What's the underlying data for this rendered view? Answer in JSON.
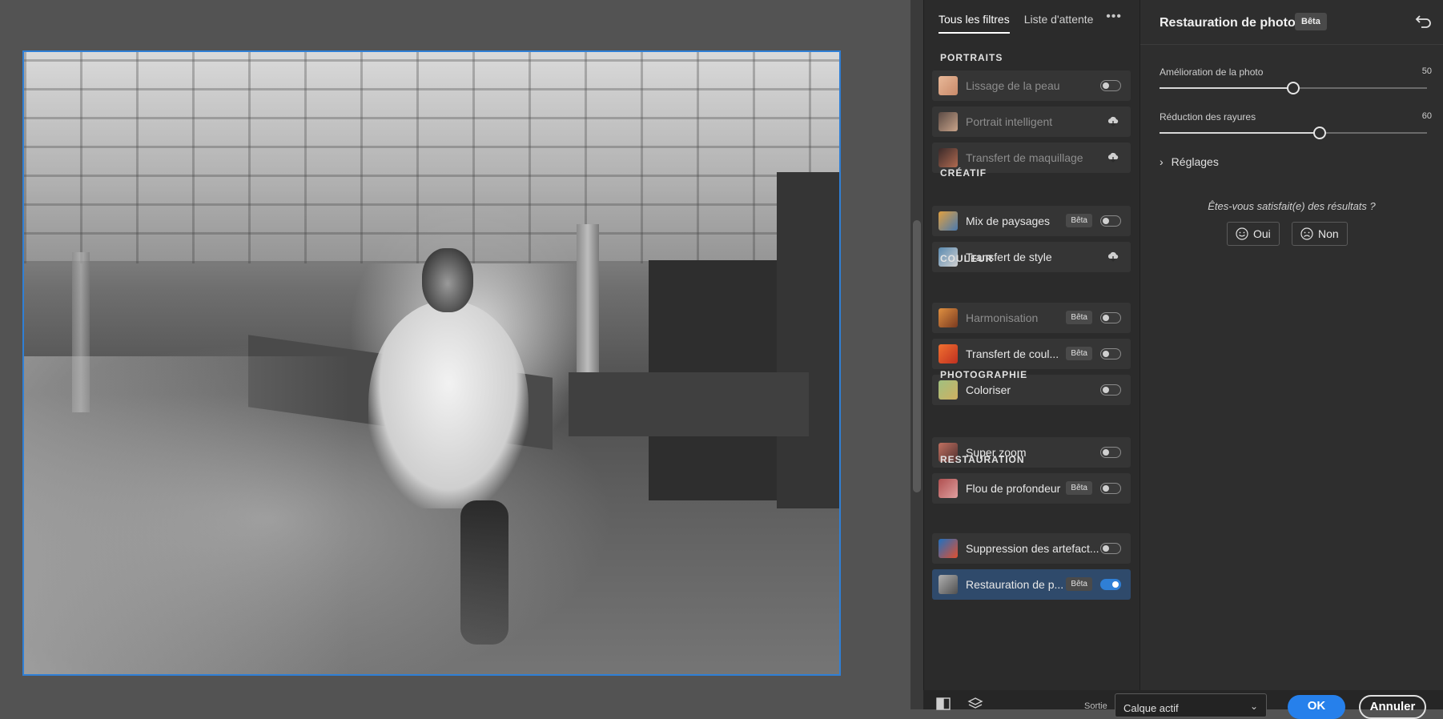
{
  "tabs": [
    {
      "label": "Tous les filtres",
      "active": true
    },
    {
      "label": "Liste d'attente",
      "active": false
    }
  ],
  "more_icon": "ellipsis-icon",
  "sections": [
    {
      "title": "PORTRAITS",
      "items": [
        {
          "label": "Lissage de la peau",
          "dim": true,
          "beta": false,
          "control": "toggle",
          "on": false,
          "thumb": [
            "#e8b898",
            "#c98a6a"
          ]
        },
        {
          "label": "Portrait intelligent",
          "dim": true,
          "beta": false,
          "control": "cloud",
          "thumb": [
            "#5a4a44",
            "#c9a48a"
          ]
        },
        {
          "label": "Transfert de maquillage",
          "dim": true,
          "beta": false,
          "control": "cloud",
          "thumb": [
            "#3a2a2a",
            "#b06a50"
          ]
        }
      ]
    },
    {
      "title": "CRÉATIF",
      "items": [
        {
          "label": "Mix de paysages",
          "dim": false,
          "beta": true,
          "control": "toggle",
          "on": false,
          "thumb": [
            "#e0a040",
            "#4a7ab0"
          ]
        },
        {
          "label": "Transfert de style",
          "dim": false,
          "beta": false,
          "control": "cloud",
          "thumb": [
            "#5a8ab0",
            "#d0d0d0"
          ]
        }
      ]
    },
    {
      "title": "COULEUR",
      "items": [
        {
          "label": "Harmonisation",
          "dim": true,
          "beta": true,
          "control": "toggle",
          "on": false,
          "thumb": [
            "#e09040",
            "#7a3a20"
          ]
        },
        {
          "label": "Transfert de coul...",
          "dim": false,
          "beta": true,
          "control": "toggle",
          "on": false,
          "thumb": [
            "#f07030",
            "#c03020"
          ]
        },
        {
          "label": "Coloriser",
          "dim": false,
          "beta": false,
          "control": "toggle",
          "on": false,
          "thumb": [
            "#a0c080",
            "#d0b060"
          ]
        }
      ]
    },
    {
      "title": "PHOTOGRAPHIE",
      "items": [
        {
          "label": "Super zoom",
          "dim": false,
          "beta": false,
          "control": "toggle",
          "on": false,
          "thumb": [
            "#c07060",
            "#503030"
          ]
        },
        {
          "label": "Flou de profondeur",
          "dim": false,
          "beta": true,
          "control": "toggle",
          "on": false,
          "thumb": [
            "#b05050",
            "#e0a0a0"
          ]
        }
      ]
    },
    {
      "title": "RESTAURATION",
      "items": [
        {
          "label": "Suppression des artefact...",
          "dim": false,
          "beta": false,
          "control": "toggle",
          "on": false,
          "thumb": [
            "#2070c0",
            "#e05030"
          ]
        },
        {
          "label": "Restauration de p...",
          "dim": false,
          "beta": true,
          "control": "toggle",
          "on": true,
          "selected": true,
          "thumb": [
            "#b0b0b0",
            "#505050"
          ]
        }
      ]
    }
  ],
  "beta_label": "Bêta",
  "props": {
    "title": "Restauration de photos",
    "beta": "Bêta",
    "reset_icon": "undo-icon",
    "sliders": [
      {
        "label": "Amélioration de la photo",
        "value": 50
      },
      {
        "label": "Réduction des rayures",
        "value": 60
      }
    ],
    "reglages": "Réglages",
    "question": "Êtes-vous satisfait(e) des résultats ?",
    "yes": "Oui",
    "no": "Non"
  },
  "bottom": {
    "sortie_label": "Sortie",
    "output_value": "Calque actif",
    "ok": "OK",
    "cancel": "Annuler"
  },
  "colors": {
    "accent": "#2680eb",
    "selection": "#2f4a6b",
    "photo_border": "#2f7fd6"
  }
}
